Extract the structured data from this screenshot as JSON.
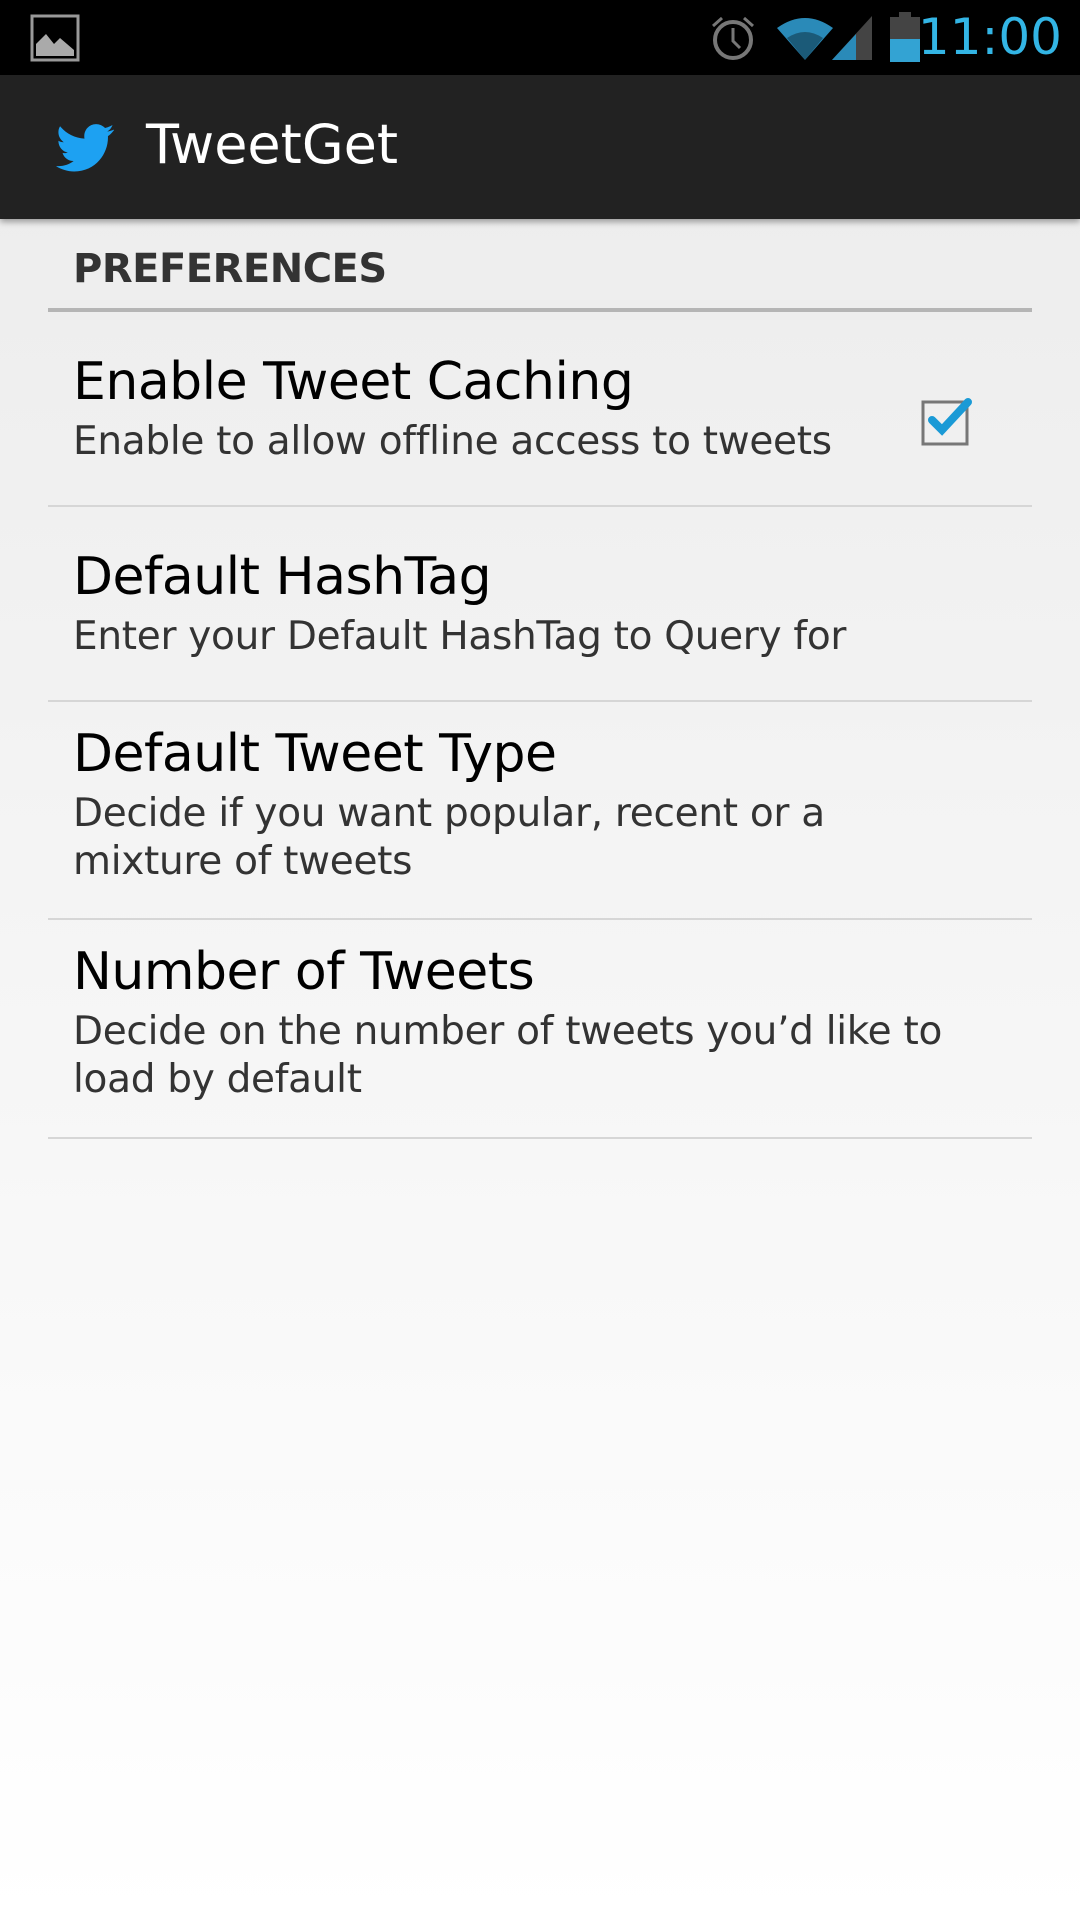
{
  "status_bar": {
    "time": "11:00",
    "icons": [
      "image-notification-icon",
      "alarm-icon",
      "wifi-icon",
      "signal-icon",
      "battery-icon"
    ]
  },
  "action_bar": {
    "title": "TweetGet",
    "icon": "twitter-bird-icon"
  },
  "preferences": {
    "category": "PREFERENCES",
    "items": [
      {
        "title": "Enable Tweet Caching",
        "summary": "Enable to allow offline access to tweets",
        "checked": true
      },
      {
        "title": "Default HashTag",
        "summary": "Enter your Default HashTag to Query for"
      },
      {
        "title": "Default Tweet Type",
        "summary": "Decide if you want popular, recent or a mixture of tweets"
      },
      {
        "title": "Number of Tweets",
        "summary": "Decide on the number of tweets you’d like to load by default"
      }
    ]
  },
  "colors": {
    "accent": "#33b5e5",
    "twitter": "#1da1f2"
  }
}
